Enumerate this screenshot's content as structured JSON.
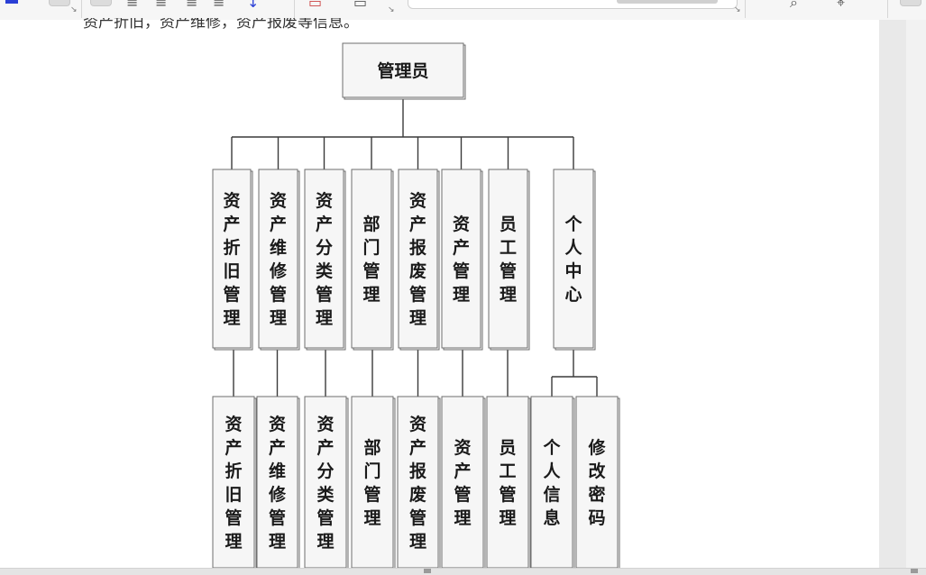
{
  "document": {
    "cut_text": "资产折旧，资产维修，资产报废等信息。"
  },
  "diagram": {
    "root": {
      "id": "root",
      "label": "管理员"
    },
    "level1": [
      {
        "id": "n1",
        "label": "资产折旧管理",
        "children": [
          {
            "id": "c1",
            "label": "资产折旧管理"
          }
        ]
      },
      {
        "id": "n2",
        "label": "资产维修管理",
        "children": [
          {
            "id": "c2",
            "label": "资产维修管理"
          }
        ]
      },
      {
        "id": "n3",
        "label": "资产分类管理",
        "children": [
          {
            "id": "c3",
            "label": "资产分类管理"
          }
        ]
      },
      {
        "id": "n4",
        "label": "部门管理",
        "children": [
          {
            "id": "c4",
            "label": "部门管理"
          }
        ]
      },
      {
        "id": "n5",
        "label": "资产报废管理",
        "children": [
          {
            "id": "c5",
            "label": "资产报废管理"
          }
        ]
      },
      {
        "id": "n6",
        "label": "资产管理",
        "children": [
          {
            "id": "c6",
            "label": "资产管理"
          }
        ]
      },
      {
        "id": "n7",
        "label": "员工管理",
        "children": [
          {
            "id": "c7",
            "label": "员工管理"
          }
        ]
      },
      {
        "id": "n8",
        "label": "个人中心",
        "children": [
          {
            "id": "c8a",
            "label": "个人信息"
          },
          {
            "id": "c8b",
            "label": "修改密码"
          }
        ]
      }
    ]
  }
}
